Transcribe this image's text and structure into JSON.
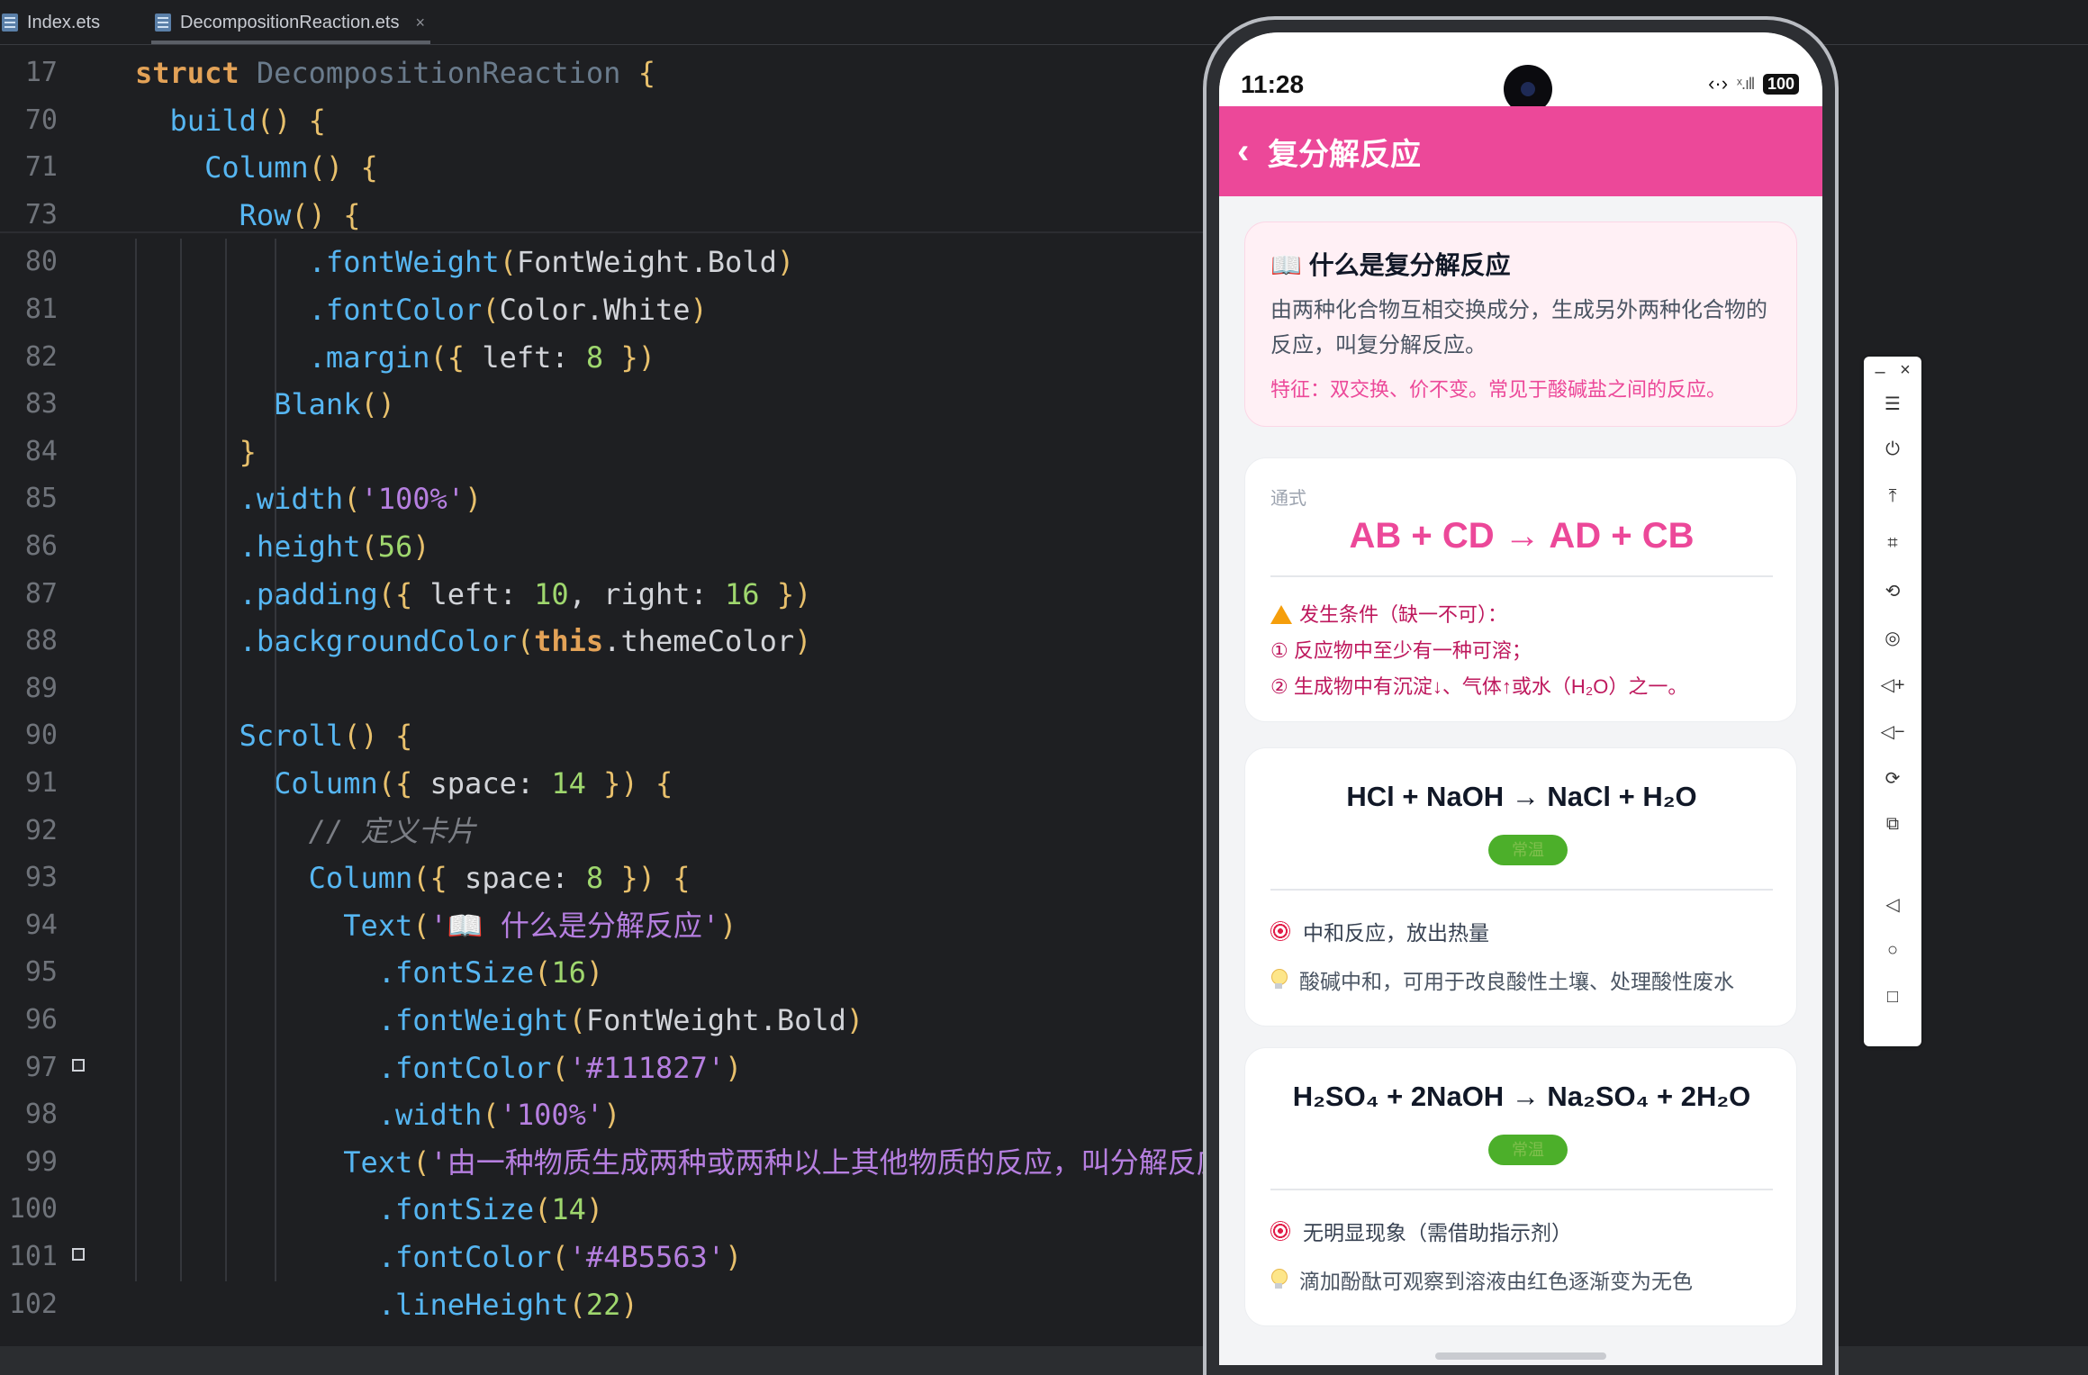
{
  "ide": {
    "tabs": [
      {
        "label": "Index.ets"
      },
      {
        "label": "DecompositionReaction.ets",
        "close": "×"
      }
    ],
    "sticky_lines": [
      {
        "num": "17",
        "tokens": [
          {
            "t": "struct ",
            "c": "kw"
          },
          {
            "t": "DecompositionReaction ",
            "c": "cls"
          },
          {
            "t": "{",
            "c": "br"
          }
        ]
      },
      {
        "num": "70",
        "tokens": [
          {
            "t": "  build",
            "c": "fn"
          },
          {
            "t": "() {",
            "c": "br"
          }
        ]
      },
      {
        "num": "71",
        "tokens": [
          {
            "t": "    Column",
            "c": "fn"
          },
          {
            "t": "() {",
            "c": "br"
          }
        ]
      },
      {
        "num": "73",
        "tokens": [
          {
            "t": "      Row",
            "c": "fn"
          },
          {
            "t": "() {",
            "c": "br"
          }
        ]
      }
    ],
    "lines": [
      {
        "num": "80",
        "tokens": [
          {
            "t": "          .fontWeight",
            "c": "fn"
          },
          {
            "t": "(",
            "c": "br"
          },
          {
            "t": "FontWeight.Bold",
            "c": "prop"
          },
          {
            "t": ")",
            "c": "br"
          }
        ]
      },
      {
        "num": "81",
        "tokens": [
          {
            "t": "          .fontColor",
            "c": "fn"
          },
          {
            "t": "(",
            "c": "br"
          },
          {
            "t": "Color.White",
            "c": "prop"
          },
          {
            "t": ")",
            "c": "br"
          }
        ]
      },
      {
        "num": "82",
        "tokens": [
          {
            "t": "          .margin",
            "c": "fn"
          },
          {
            "t": "({ ",
            "c": "br"
          },
          {
            "t": "left: ",
            "c": "prop"
          },
          {
            "t": "8",
            "c": "num"
          },
          {
            "t": " })",
            "c": "br"
          }
        ]
      },
      {
        "num": "83",
        "tokens": [
          {
            "t": "        Blank",
            "c": "fn"
          },
          {
            "t": "()",
            "c": "br"
          }
        ]
      },
      {
        "num": "84",
        "tokens": [
          {
            "t": "      }",
            "c": "br"
          }
        ]
      },
      {
        "num": "85",
        "tokens": [
          {
            "t": "      .width",
            "c": "fn"
          },
          {
            "t": "(",
            "c": "br"
          },
          {
            "t": "'100%'",
            "c": "str"
          },
          {
            "t": ")",
            "c": "br"
          }
        ]
      },
      {
        "num": "86",
        "tokens": [
          {
            "t": "      .height",
            "c": "fn"
          },
          {
            "t": "(",
            "c": "br"
          },
          {
            "t": "56",
            "c": "num"
          },
          {
            "t": ")",
            "c": "br"
          }
        ]
      },
      {
        "num": "87",
        "tokens": [
          {
            "t": "      .padding",
            "c": "fn"
          },
          {
            "t": "({ ",
            "c": "br"
          },
          {
            "t": "left: ",
            "c": "prop"
          },
          {
            "t": "10",
            "c": "num"
          },
          {
            "t": ", ",
            "c": "prop"
          },
          {
            "t": "right: ",
            "c": "prop"
          },
          {
            "t": "16",
            "c": "num"
          },
          {
            "t": " })",
            "c": "br"
          }
        ]
      },
      {
        "num": "88",
        "tokens": [
          {
            "t": "      .backgroundColor",
            "c": "fn"
          },
          {
            "t": "(",
            "c": "br"
          },
          {
            "t": "this",
            "c": "kw"
          },
          {
            "t": ".themeColor",
            "c": "prop"
          },
          {
            "t": ")",
            "c": "br"
          }
        ]
      },
      {
        "num": "89",
        "tokens": []
      },
      {
        "num": "90",
        "tokens": [
          {
            "t": "      Scroll",
            "c": "fn"
          },
          {
            "t": "() {",
            "c": "br"
          }
        ]
      },
      {
        "num": "91",
        "tokens": [
          {
            "t": "        Column",
            "c": "fn"
          },
          {
            "t": "({ ",
            "c": "br"
          },
          {
            "t": "space: ",
            "c": "prop"
          },
          {
            "t": "14",
            "c": "num"
          },
          {
            "t": " }) {",
            "c": "br"
          }
        ]
      },
      {
        "num": "92",
        "tokens": [
          {
            "t": "          // 定义卡片",
            "c": "cmt"
          }
        ]
      },
      {
        "num": "93",
        "tokens": [
          {
            "t": "          Column",
            "c": "fn"
          },
          {
            "t": "({ ",
            "c": "br"
          },
          {
            "t": "space: ",
            "c": "prop"
          },
          {
            "t": "8",
            "c": "num"
          },
          {
            "t": " }) {",
            "c": "br"
          }
        ]
      },
      {
        "num": "94",
        "tokens": [
          {
            "t": "            Text",
            "c": "fn"
          },
          {
            "t": "(",
            "c": "br"
          },
          {
            "t": "'📖 什么是分解反应'",
            "c": "str"
          },
          {
            "t": ")",
            "c": "br"
          }
        ]
      },
      {
        "num": "95",
        "tokens": [
          {
            "t": "              .fontSize",
            "c": "fn"
          },
          {
            "t": "(",
            "c": "br"
          },
          {
            "t": "16",
            "c": "num"
          },
          {
            "t": ")",
            "c": "br"
          }
        ]
      },
      {
        "num": "96",
        "tokens": [
          {
            "t": "              .fontWeight",
            "c": "fn"
          },
          {
            "t": "(",
            "c": "br"
          },
          {
            "t": "FontWeight.Bold",
            "c": "prop"
          },
          {
            "t": ")",
            "c": "br"
          }
        ]
      },
      {
        "num": "97",
        "gutter": true,
        "tokens": [
          {
            "t": "              .fontColor",
            "c": "fn"
          },
          {
            "t": "(",
            "c": "br"
          },
          {
            "t": "'#111827'",
            "c": "str"
          },
          {
            "t": ")",
            "c": "br"
          }
        ]
      },
      {
        "num": "98",
        "tokens": [
          {
            "t": "              .width",
            "c": "fn"
          },
          {
            "t": "(",
            "c": "br"
          },
          {
            "t": "'100%'",
            "c": "str"
          },
          {
            "t": ")",
            "c": "br"
          }
        ]
      },
      {
        "num": "99",
        "tokens": [
          {
            "t": "            Text",
            "c": "fn"
          },
          {
            "t": "(",
            "c": "br"
          },
          {
            "t": "'由一种物质生成两种或两种以上其他物质的反应，叫分解反应。",
            "c": "str"
          }
        ]
      },
      {
        "num": "100",
        "tokens": [
          {
            "t": "              .fontSize",
            "c": "fn"
          },
          {
            "t": "(",
            "c": "br"
          },
          {
            "t": "14",
            "c": "num"
          },
          {
            "t": ")",
            "c": "br"
          }
        ]
      },
      {
        "num": "101",
        "gutter": true,
        "tokens": [
          {
            "t": "              .fontColor",
            "c": "fn"
          },
          {
            "t": "(",
            "c": "br"
          },
          {
            "t": "'#4B5563'",
            "c": "str"
          },
          {
            "t": ")",
            "c": "br"
          }
        ]
      },
      {
        "num": "102",
        "tokens": [
          {
            "t": "              .lineHeight",
            "c": "fn"
          },
          {
            "t": "(",
            "c": "br"
          },
          {
            "t": "22",
            "c": "num"
          },
          {
            "t": ")",
            "c": "br"
          }
        ]
      }
    ]
  },
  "phone": {
    "time": "11:28",
    "status_icons": {
      "nfc": "‹·›",
      "signal": "ˣ.ıll",
      "battery": "100"
    },
    "appbar": {
      "back": "‹",
      "title": "复分解反应"
    },
    "intro_card": {
      "title": "📖 什么是复分解反应",
      "body": "由两种化合物互相交换成分，生成另外两种化合物的反应，叫复分解反应。",
      "feature": "特征：双交换、价不变。常见于酸碱盐之间的反应。"
    },
    "formula_card": {
      "label": "通式",
      "formula": "AB + CD → AD + CB",
      "condition_title": "发生条件（缺一不可）：",
      "condition_1": "① 反应物中至少有一种可溶；",
      "condition_2": "② 生成物中有沉淀↓、气体↑或水（H₂O）之一。"
    },
    "reactions": [
      {
        "equation": "HCl + NaOH → NaCl + H₂O",
        "tag": "常温",
        "phenomenon": "中和反应，放出热量",
        "application": "酸碱中和，可用于改良酸性土壤、处理酸性废水"
      },
      {
        "equation": "H₂SO₄ + 2NaOH → Na₂SO₄ + 2H₂O",
        "tag": "常温",
        "phenomenon": "无明显现象（需借助指示剂）",
        "application": "滴加酚酞可观察到溶液由红色逐渐变为无色"
      }
    ],
    "colors": {
      "theme": "#ec4899",
      "tag": "#4caf2a",
      "heading": "#111827",
      "body": "#4b5563"
    }
  },
  "toolbar": {
    "minimize": "–",
    "close": "×",
    "items": [
      {
        "name": "menu-icon",
        "glyph": "☰"
      },
      {
        "name": "power-icon",
        "glyph": "⏻"
      },
      {
        "name": "pin-top-icon",
        "glyph": "⤒"
      },
      {
        "name": "crop-icon",
        "glyph": "⌗"
      },
      {
        "name": "rotate-icon",
        "glyph": "⟲"
      },
      {
        "name": "location-icon",
        "glyph": "◎"
      },
      {
        "name": "volume-up-icon",
        "glyph": "◁+"
      },
      {
        "name": "volume-down-icon",
        "glyph": "◁−"
      },
      {
        "name": "shake-icon",
        "glyph": "⟳"
      },
      {
        "name": "multi-device-icon",
        "glyph": "⧉"
      },
      {
        "name": "back-nav-icon",
        "glyph": "◁"
      },
      {
        "name": "home-nav-icon",
        "glyph": "○"
      },
      {
        "name": "recent-nav-icon",
        "glyph": "□"
      }
    ]
  }
}
